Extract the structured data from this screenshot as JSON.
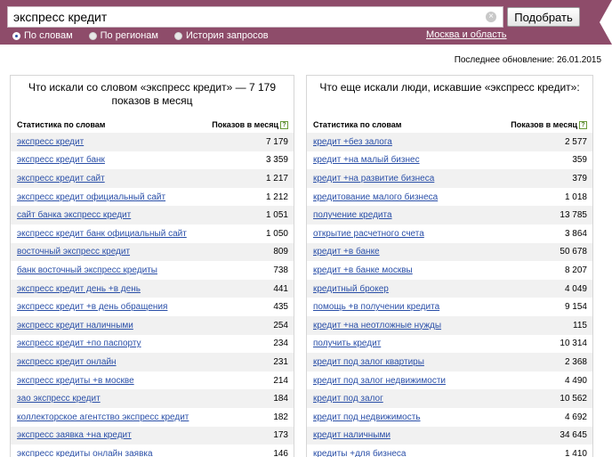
{
  "search": {
    "value": "экспресс кредит",
    "submit_label": "Подобрать",
    "clear_symbol": "×"
  },
  "modes": [
    {
      "label": "По словам",
      "selected": true
    },
    {
      "label": "По регионам",
      "selected": false
    },
    {
      "label": "История запросов",
      "selected": false
    }
  ],
  "region": "Москва и область",
  "last_update": "Последнее обновление: 26.01.2015",
  "colors": {
    "topbar": "#8e4c6a",
    "link": "#2a4fa8",
    "stripe": "#f1f1f1"
  },
  "left": {
    "title": "Что искали со словом «экспресс кредит» — 7 179 показов в месяц",
    "col_phrase": "Статистика по словам",
    "col_shows": "Показов в месяц",
    "help": "?",
    "rows": [
      {
        "phrase": "экспресс кредит",
        "shows": "7 179"
      },
      {
        "phrase": "экспресс кредит банк",
        "shows": "3 359"
      },
      {
        "phrase": "экспресс кредит сайт",
        "shows": "1 217"
      },
      {
        "phrase": "экспресс кредит официальный сайт",
        "shows": "1 212"
      },
      {
        "phrase": "сайт банка экспресс кредит",
        "shows": "1 051"
      },
      {
        "phrase": "экспресс кредит банк официальный сайт",
        "shows": "1 050"
      },
      {
        "phrase": "восточный экспресс кредит",
        "shows": "809"
      },
      {
        "phrase": "банк восточный экспресс кредиты",
        "shows": "738"
      },
      {
        "phrase": "экспресс кредит день +в день",
        "shows": "441"
      },
      {
        "phrase": "экспресс кредит +в день обращения",
        "shows": "435"
      },
      {
        "phrase": "экспресс кредит наличными",
        "shows": "254"
      },
      {
        "phrase": "экспресс кредит +по паспорту",
        "shows": "234"
      },
      {
        "phrase": "экспресс кредит онлайн",
        "shows": "231"
      },
      {
        "phrase": "экспресс кредиты +в москве",
        "shows": "214"
      },
      {
        "phrase": "зао экспресс кредит",
        "shows": "184"
      },
      {
        "phrase": "коллекторское агентство экспресс кредит",
        "shows": "182"
      },
      {
        "phrase": "экспресс заявка +на кредит",
        "shows": "173"
      },
      {
        "phrase": "экспресс кредиты онлайн заявка",
        "shows": "146"
      }
    ]
  },
  "right": {
    "title": "Что еще искали люди, искавшие «экспресс кредит»:",
    "col_phrase": "Статистика по словам",
    "col_shows": "Показов в месяц",
    "help": "?",
    "rows": [
      {
        "phrase": "кредит +без залога",
        "shows": "2 577"
      },
      {
        "phrase": "кредит +на малый бизнес",
        "shows": "359"
      },
      {
        "phrase": "кредит +на развитие бизнеса",
        "shows": "379"
      },
      {
        "phrase": "кредитование малого бизнеса",
        "shows": "1 018"
      },
      {
        "phrase": "получение кредита",
        "shows": "13 785"
      },
      {
        "phrase": "открытие расчетного счета",
        "shows": "3 864"
      },
      {
        "phrase": "кредит +в банке",
        "shows": "50 678"
      },
      {
        "phrase": "кредит +в банке москвы",
        "shows": "8 207"
      },
      {
        "phrase": "кредитный брокер",
        "shows": "4 049"
      },
      {
        "phrase": "помощь +в получении кредита",
        "shows": "9 154"
      },
      {
        "phrase": "кредит +на неотложные нужды",
        "shows": "115"
      },
      {
        "phrase": "получить кредит",
        "shows": "10 314"
      },
      {
        "phrase": "кредит под залог квартиры",
        "shows": "2 368"
      },
      {
        "phrase": "кредит под залог недвижимости",
        "shows": "4 490"
      },
      {
        "phrase": "кредит под залог",
        "shows": "10 562"
      },
      {
        "phrase": "кредит под недвижимость",
        "shows": "4 692"
      },
      {
        "phrase": "кредит наличными",
        "shows": "34 645"
      },
      {
        "phrase": "кредиты +для бизнеса",
        "shows": "1 410"
      }
    ]
  }
}
